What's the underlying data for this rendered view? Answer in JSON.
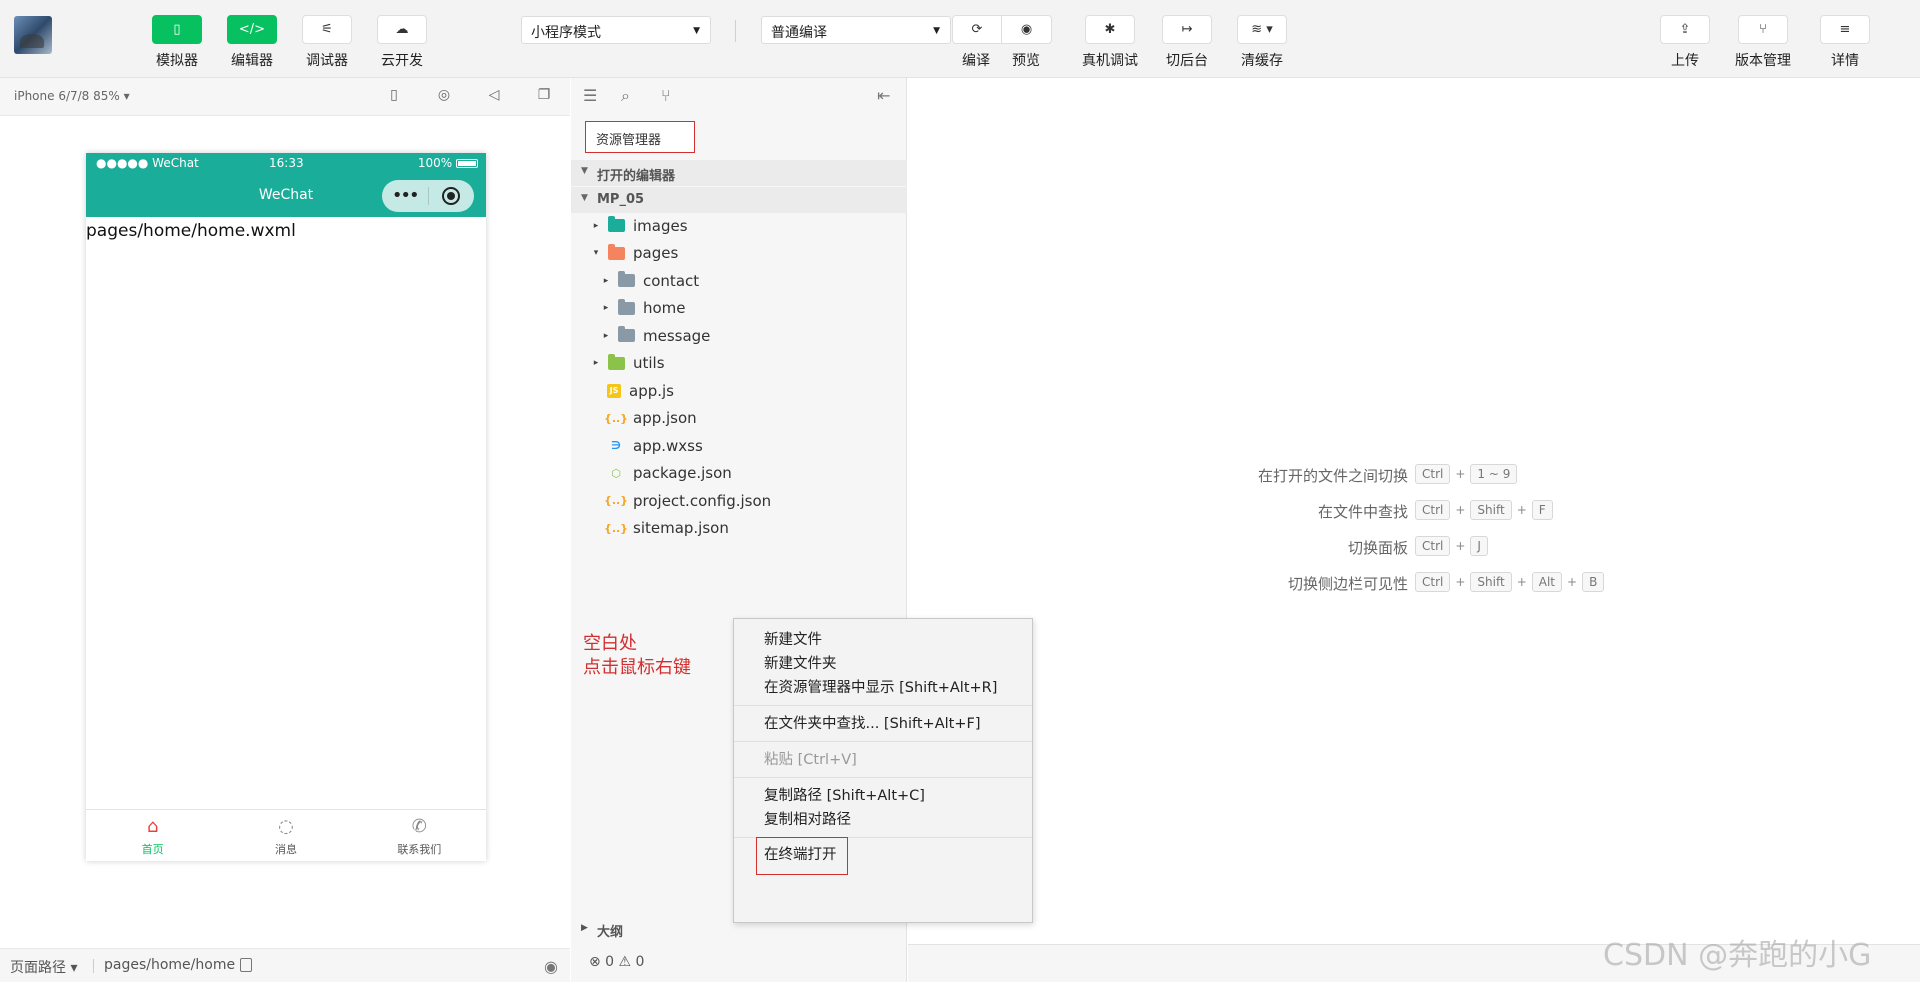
{
  "toolbar": {
    "simulator": "模拟器",
    "editor": "编辑器",
    "debugger": "调试器",
    "cloud": "云开发",
    "mode_select": "小程序模式",
    "compile_select": "普通编译",
    "compile": "编译",
    "preview": "预览",
    "real_debug": "真机调试",
    "background": "切后台",
    "clear_cache": "清缓存",
    "upload": "上传",
    "version": "版本管理",
    "details": "详情"
  },
  "simulator": {
    "device": "iPhone 6/7/8 85% ▾",
    "status_left": "●●●●● WeChat",
    "status_time": "16:33",
    "status_battery": "100%",
    "nav_title": "WeChat",
    "content": "pages/home/home.wxml",
    "tabs": [
      {
        "label": "首页",
        "icon": "home-icon"
      },
      {
        "label": "消息",
        "icon": "message-icon"
      },
      {
        "label": "联系我们",
        "icon": "phone-icon"
      }
    ],
    "footer_path_label": "页面路径 ▾",
    "footer_path": "pages/home/home"
  },
  "explorer": {
    "title": "资源管理器",
    "open_editors": "打开的编辑器",
    "project": "MP_05",
    "tree": [
      {
        "name": "images",
        "depth": 1,
        "arrow": "▸",
        "icon": "images-folder",
        "color": "#1aad9a"
      },
      {
        "name": "pages",
        "depth": 1,
        "arrow": "▾",
        "icon": "pages-folder",
        "color": "#f4845f"
      },
      {
        "name": "contact",
        "depth": 2,
        "arrow": "▸",
        "icon": "folder",
        "color": "#8a99a6"
      },
      {
        "name": "home",
        "depth": 2,
        "arrow": "▸",
        "icon": "folder",
        "color": "#8a99a6"
      },
      {
        "name": "message",
        "depth": 2,
        "arrow": "▸",
        "icon": "folder",
        "color": "#8a99a6"
      },
      {
        "name": "utils",
        "depth": 1,
        "arrow": "▸",
        "icon": "utils-folder",
        "color": "#8bc34a"
      },
      {
        "name": "app.js",
        "depth": 1,
        "arrow": "",
        "icon": "js",
        "color": "#f5c518"
      },
      {
        "name": "app.json",
        "depth": 1,
        "arrow": "",
        "icon": "json",
        "color": "#f5a623"
      },
      {
        "name": "app.wxss",
        "depth": 1,
        "arrow": "",
        "icon": "css",
        "color": "#2196f3"
      },
      {
        "name": "package.json",
        "depth": 1,
        "arrow": "",
        "icon": "node",
        "color": "#8bc34a"
      },
      {
        "name": "project.config.json",
        "depth": 1,
        "arrow": "",
        "icon": "json",
        "color": "#f5a623"
      },
      {
        "name": "sitemap.json",
        "depth": 1,
        "arrow": "",
        "icon": "json",
        "color": "#f5a623"
      }
    ],
    "annotation_line1": "空白处",
    "annotation_line2": "点击鼠标右键",
    "outline": "大纲",
    "status": "⊗ 0 ⚠ 0"
  },
  "shortcuts": [
    {
      "label": "在打开的文件之间切换",
      "keys": [
        "Ctrl",
        "1 ~ 9"
      ]
    },
    {
      "label": "在文件中查找",
      "keys": [
        "Ctrl",
        "Shift",
        "F"
      ]
    },
    {
      "label": "切换面板",
      "keys": [
        "Ctrl",
        "J"
      ]
    },
    {
      "label": "切换侧边栏可见性",
      "keys": [
        "Ctrl",
        "Shift",
        "Alt",
        "B"
      ]
    }
  ],
  "context_menu": {
    "new_file": "新建文件",
    "new_folder": "新建文件夹",
    "reveal": "在资源管理器中显示  [Shift+Alt+R]",
    "find_in_folder": "在文件夹中查找...  [Shift+Alt+F]",
    "paste": "粘贴  [Ctrl+V]",
    "copy_path": "复制路径  [Shift+Alt+C]",
    "copy_relative": "复制相对路径",
    "open_terminal": "在终端打开"
  },
  "watermark": "CSDN @奔跑的小G"
}
